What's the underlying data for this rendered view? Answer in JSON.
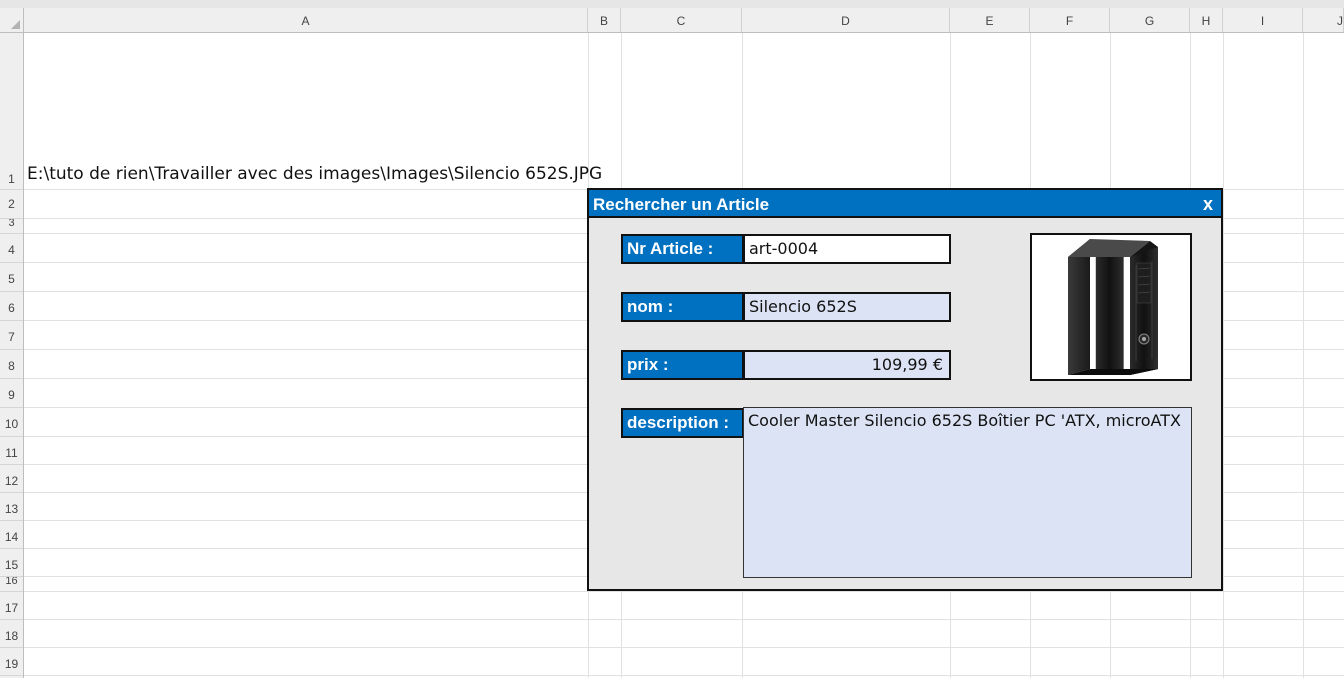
{
  "columns": [
    "A",
    "B",
    "C",
    "D",
    "E",
    "F",
    "G",
    "H",
    "I",
    "J"
  ],
  "rows": [
    "1",
    "2",
    "3",
    "4",
    "5",
    "6",
    "7",
    "8",
    "9",
    "10",
    "11",
    "12",
    "13",
    "14",
    "15",
    "16",
    "17",
    "18",
    "19"
  ],
  "cells": {
    "A1": "E:\\tuto de rien\\Travailler avec des images\\Images\\Silencio 652S.JPG"
  },
  "form": {
    "title": "Rechercher un Article",
    "close_label": "x",
    "labels": {
      "nr_article": "Nr Article :",
      "nom": "nom :",
      "prix": "prix :",
      "description": "description :"
    },
    "values": {
      "nr_article": "art-0004",
      "nom": "Silencio 652S",
      "prix": "109,99 €",
      "description": "Cooler Master Silencio 652S Boîtier PC 'ATX, microATX"
    },
    "image_icon": "pc-case-icon"
  },
  "colors": {
    "form_blue": "#0070c0",
    "field_fill": "#dce3f4",
    "form_bg": "#e7e7e7"
  }
}
